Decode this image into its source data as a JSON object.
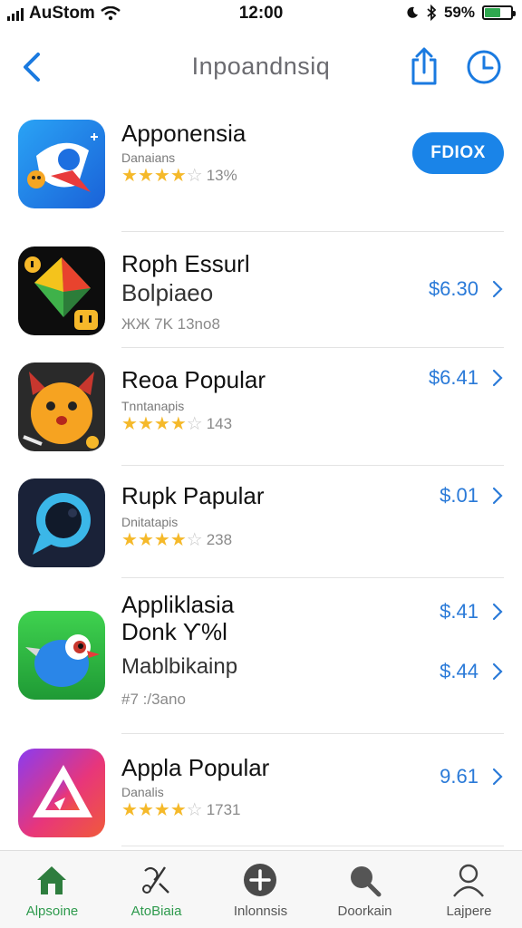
{
  "status_bar": {
    "carrier": "AuStom",
    "time": "12:00",
    "battery_text": "59%",
    "battery_level": 0.59
  },
  "nav": {
    "title": "Inpoandnsiq",
    "back_icon": "chevron-left-icon",
    "share_icon": "share-icon",
    "history_icon": "clock-icon"
  },
  "apps": [
    {
      "name": "Apponensia",
      "subtitle": "Danaians",
      "rating": 4,
      "rating_count": "13%",
      "action": "FDIOX"
    },
    {
      "name": "Roph Essurl",
      "name2": "Bolpiaeo",
      "rating_text": "ЖЖ 7K 13no8",
      "price": "$6.30"
    },
    {
      "name": "Reoa Popular",
      "subtitle": "Tnntanapis",
      "rating": 4,
      "rating_count": "143",
      "price": "$6.41"
    },
    {
      "name": "Rupk Papular",
      "subtitle": "Dnitatapis",
      "rating": 4,
      "rating_count": "238",
      "price": "$.01"
    },
    {
      "name": "Appliklasia",
      "name2": "Donk Ƴ%l",
      "name3": "Mablbikainp",
      "rating_text": "#7 :/3ano",
      "price": "$.41",
      "price2": "$.44"
    },
    {
      "name": "Appla Popular",
      "subtitle": "Danalis",
      "rating": 4,
      "rating_count": "1731",
      "price": "9.61"
    }
  ],
  "tabs": [
    {
      "label": "Alpsoine",
      "icon": "home-icon",
      "active": true
    },
    {
      "label": "AtoBiaia",
      "icon": "tools-icon",
      "active": false
    },
    {
      "label": "Inlonnsis",
      "icon": "add-circle-icon",
      "active": false
    },
    {
      "label": "Doorkain",
      "icon": "search-icon",
      "active": false
    },
    {
      "label": "Lajpere",
      "icon": "profile-icon",
      "active": false
    }
  ],
  "colors": {
    "accent": "#1a84e8",
    "price": "#2a7ad8",
    "star": "#f5b92a",
    "tab_active": "#2e9a4d"
  }
}
